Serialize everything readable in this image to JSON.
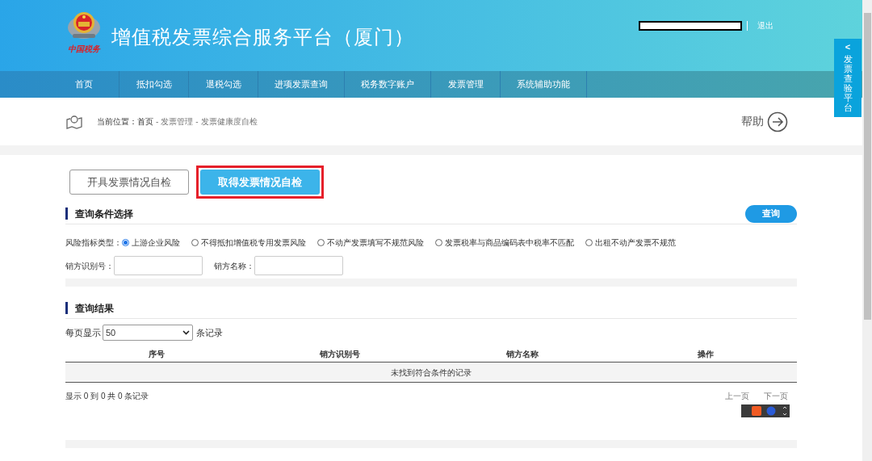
{
  "header": {
    "title": "增值税发票综合服务平台（厦门）",
    "logo_caption": "中国税务",
    "logout": "退出"
  },
  "nav": [
    {
      "label": "首页",
      "selected": false
    },
    {
      "label": "抵扣勾选",
      "selected": false
    },
    {
      "label": "退税勾选",
      "selected": false
    },
    {
      "label": "进项发票查询",
      "selected": false
    },
    {
      "label": "税务数字账户",
      "selected": false
    },
    {
      "label": "发票管理",
      "selected": false
    },
    {
      "label": "系统辅助功能",
      "selected": false
    }
  ],
  "side_tab": {
    "arrow": "<",
    "label": "发票查验平台"
  },
  "breadcrumb": {
    "prefix": "当前位置：",
    "items": [
      "首页",
      "发票管理",
      "发票健康度自检"
    ],
    "separator": "-"
  },
  "help": "帮助",
  "tabs": [
    {
      "label": "开具发票情况自检",
      "selected": false,
      "highlighted": false
    },
    {
      "label": "取得发票情况自检",
      "selected": true,
      "highlighted": true
    }
  ],
  "query": {
    "title": "查询条件选择",
    "button": "查询",
    "risk_label": "风险指标类型：",
    "risk_options": [
      {
        "label": "上游企业风险",
        "selected": true
      },
      {
        "label": "不得抵扣增值税专用发票风险",
        "selected": false
      },
      {
        "label": "不动产发票填写不规范风险",
        "selected": false
      },
      {
        "label": "发票税率与商品编码表中税率不匹配",
        "selected": false
      },
      {
        "label": "出租不动产发票不规范",
        "selected": false
      }
    ],
    "fields": [
      {
        "label": "销方识别号："
      },
      {
        "label": "销方名称："
      }
    ]
  },
  "results": {
    "title": "查询结果",
    "per_page_prefix": "每页显示",
    "per_page_value": "50",
    "per_page_suffix": "条记录",
    "columns": [
      "序号",
      "销方识别号",
      "销方名称",
      "操作"
    ],
    "empty_message": "未找到符合条件的记录",
    "summary": "显示 0 到 0 共 0 条记录",
    "prev": "上一页",
    "next": "下一页"
  }
}
